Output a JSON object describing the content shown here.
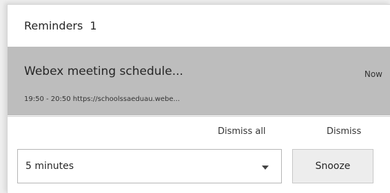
{
  "header": {
    "title": "Reminders",
    "count": "1"
  },
  "reminder": {
    "subject": "Webex meeting schedule...",
    "time_label": "Now",
    "details": "19:50 - 20:50 https://schoolssaeduau.webe..."
  },
  "actions": {
    "dismiss_all": "Dismiss all",
    "dismiss": "Dismiss",
    "snooze_select": {
      "selected": "5 minutes"
    },
    "snooze": "Snooze"
  }
}
